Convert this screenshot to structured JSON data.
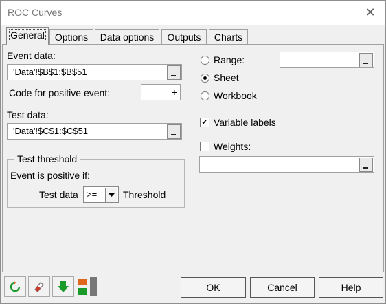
{
  "window": {
    "title": "ROC Curves",
    "close_glyph": "✕"
  },
  "tabs": [
    {
      "label": "General",
      "active": true
    },
    {
      "label": "Options"
    },
    {
      "label": "Data options"
    },
    {
      "label": "Outputs"
    },
    {
      "label": "Charts"
    }
  ],
  "general": {
    "event_data_label": "Event data:",
    "event_data_value": "'Data'!$B$1:$B$51",
    "code_positive_label": "Code for positive event:",
    "code_positive_value": "+",
    "test_data_label": "Test data:",
    "test_data_value": "'Data'!$C$1:$C$51",
    "threshold_group_title": "Test threshold",
    "event_positive_if": "Event is positive if:",
    "test_data_text": "Test data",
    "operator_value": ">=",
    "threshold_text": "Threshold",
    "range_label": "Range:",
    "range_value": "",
    "sheet_label": "Sheet",
    "workbook_label": "Workbook",
    "selected_output": "Sheet",
    "variable_labels_label": "Variable labels",
    "variable_labels_checked": true,
    "weights_label": "Weights:",
    "weights_checked": false,
    "weights_value": ""
  },
  "footer": {
    "ok_label": "OK",
    "cancel_label": "Cancel",
    "help_label": "Help",
    "icons": [
      "reset-icon",
      "eraser-icon",
      "download-arrow-icon",
      "dock-icon"
    ]
  },
  "colors": {
    "green": "#1a9a2a",
    "orange": "#e0661b",
    "tab_border": "#a0a0a0"
  }
}
